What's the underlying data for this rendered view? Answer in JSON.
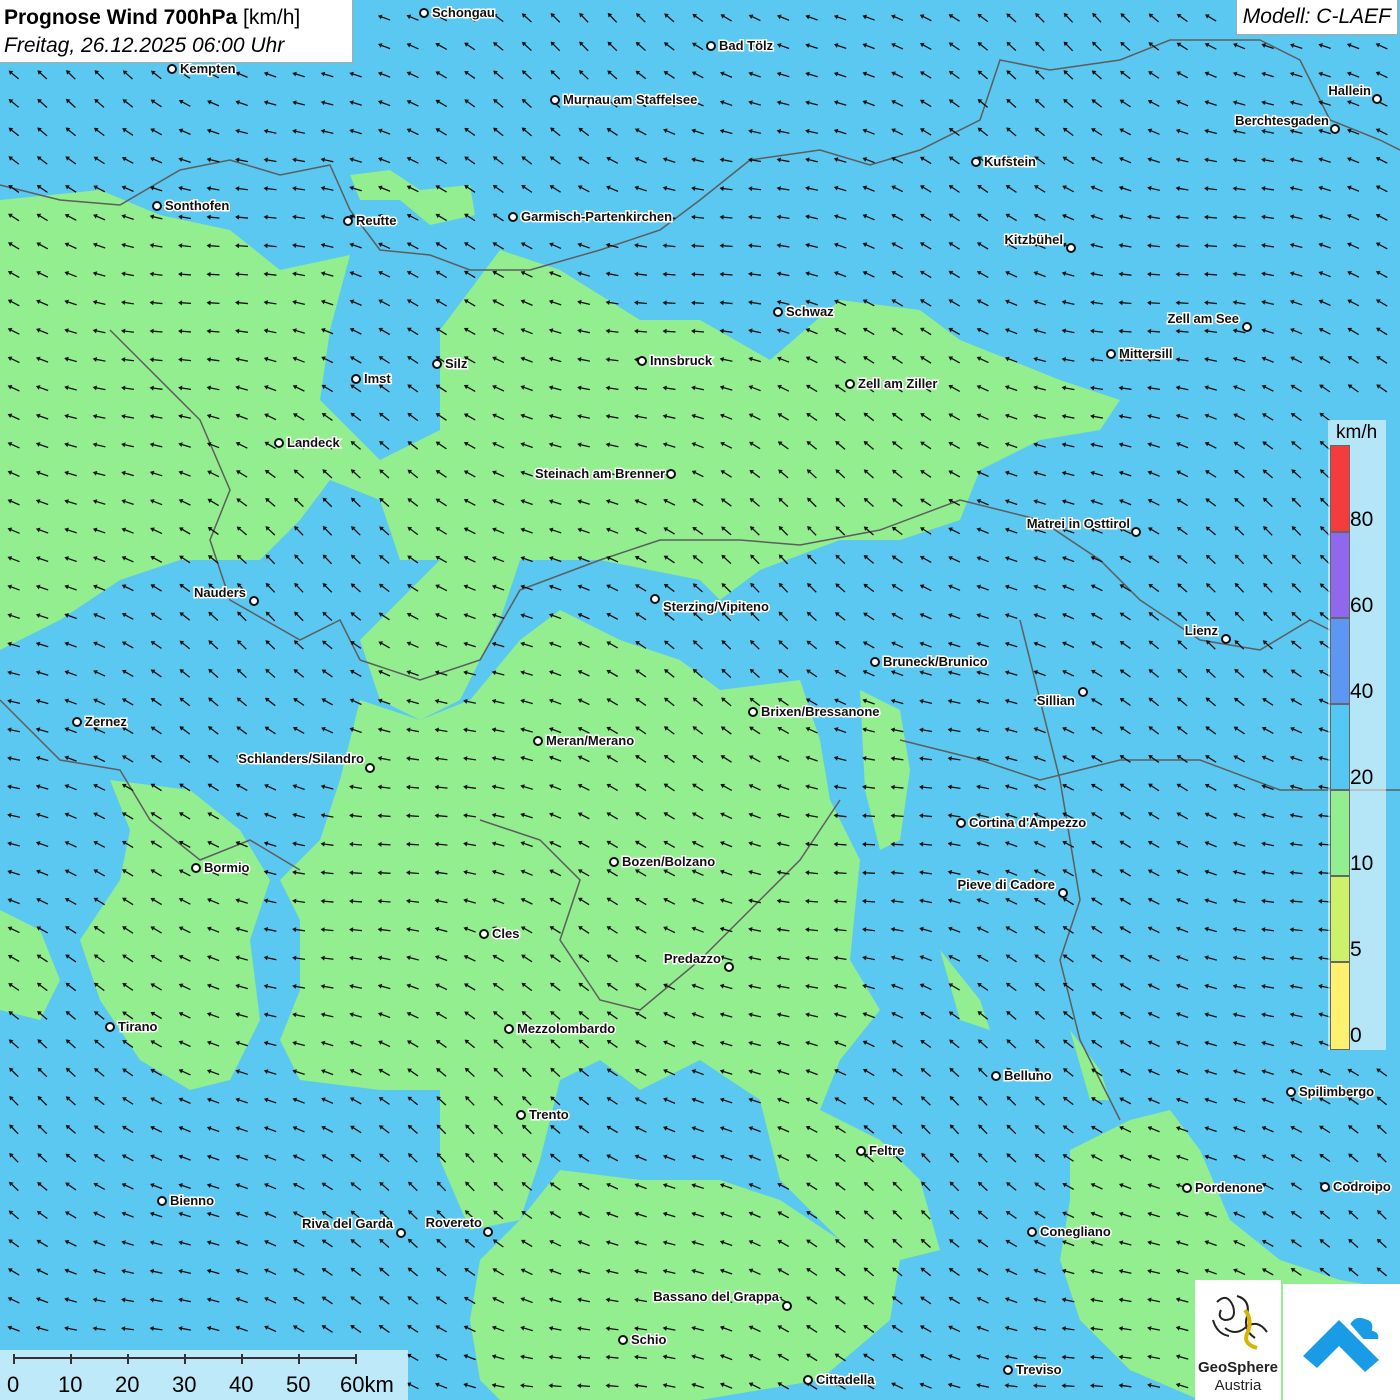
{
  "title": {
    "bold": "Prognose Wind 700hPa",
    "unit": "[km/h]",
    "datetime": "Freitag, 26.12.2025 06:00 Uhr"
  },
  "model": "Modell: C-LAEF",
  "legend": {
    "unit": "km/h",
    "ticks": [
      "0",
      "5",
      "10",
      "20",
      "40",
      "60",
      "80"
    ],
    "colors": [
      "#fff170",
      "#cdf26a",
      "#92ee8e",
      "#54c8f4",
      "#5e96f4",
      "#9068ee",
      "#f43c3c"
    ]
  },
  "scalebar": {
    "labels": [
      "0",
      "10",
      "20",
      "30",
      "40",
      "50",
      "60km"
    ]
  },
  "colors": {
    "wind_10_20": "#92ee8e",
    "wind_20_40": "#5ac8f0",
    "borders": "#5d5d5d",
    "arrows": "#111111"
  },
  "cities": [
    {
      "name": "Schongau",
      "side": "right"
    },
    {
      "name": "Bad Tölz",
      "side": "right"
    },
    {
      "name": "Kempten",
      "side": "right"
    },
    {
      "name": "Murnau am Staffelsee",
      "side": "right"
    },
    {
      "name": "Hallein",
      "side": "left"
    },
    {
      "name": "Berchtesgaden",
      "side": "left"
    },
    {
      "name": "Kufstein",
      "side": "right"
    },
    {
      "name": "Sonthofen",
      "side": "right"
    },
    {
      "name": "Reutte",
      "side": "right"
    },
    {
      "name": "Garmisch-Partenkirchen",
      "side": "right"
    },
    {
      "name": "Kitzbühel",
      "side": "left"
    },
    {
      "name": "Schwaz",
      "side": "right"
    },
    {
      "name": "Zell am See",
      "side": "left"
    },
    {
      "name": "Mittersill",
      "side": "right"
    },
    {
      "name": "Innsbruck",
      "side": "right"
    },
    {
      "name": "Silz",
      "side": "right"
    },
    {
      "name": "Imst",
      "side": "right"
    },
    {
      "name": "Zell am Ziller",
      "side": "right"
    },
    {
      "name": "Landeck",
      "side": "right"
    },
    {
      "name": "Steinach am Brenner",
      "side": "left"
    },
    {
      "name": "Matrei in Osttirol",
      "side": "left"
    },
    {
      "name": "Nauders",
      "side": "left"
    },
    {
      "name": "Sterzing/Vipiteno",
      "side": "right"
    },
    {
      "name": "Lienz",
      "side": "left"
    },
    {
      "name": "Bruneck/Brunico",
      "side": "right"
    },
    {
      "name": "Sillian",
      "side": "left"
    },
    {
      "name": "Brixen/Bressanone",
      "side": "right"
    },
    {
      "name": "Zernez",
      "side": "right"
    },
    {
      "name": "Meran/Merano",
      "side": "right"
    },
    {
      "name": "Schlanders/Silandro",
      "side": "left"
    },
    {
      "name": "Cortina d'Ampezzo",
      "side": "right"
    },
    {
      "name": "Bozen/Bolzano",
      "side": "right"
    },
    {
      "name": "Bormio",
      "side": "right"
    },
    {
      "name": "Pieve di Cadore",
      "side": "left"
    },
    {
      "name": "Cles",
      "side": "right"
    },
    {
      "name": "Predazzo",
      "side": "left"
    },
    {
      "name": "Tirano",
      "side": "right"
    },
    {
      "name": "Mezzolombardo",
      "side": "right"
    },
    {
      "name": "Belluno",
      "side": "right"
    },
    {
      "name": "Spilimbergo",
      "side": "right"
    },
    {
      "name": "Trento",
      "side": "right"
    },
    {
      "name": "Feltre",
      "side": "right"
    },
    {
      "name": "Pordenone",
      "side": "right"
    },
    {
      "name": "Codroipo",
      "side": "right"
    },
    {
      "name": "Bienno",
      "side": "right"
    },
    {
      "name": "Riva del Garda",
      "side": "left"
    },
    {
      "name": "Rovereto",
      "side": "left"
    },
    {
      "name": "Conegliano",
      "side": "right"
    },
    {
      "name": "Bassano del Grappa",
      "side": "left"
    },
    {
      "name": "Schio",
      "side": "right"
    },
    {
      "name": "Treviso",
      "side": "right"
    },
    {
      "name": "Cittadella",
      "side": "right"
    }
  ],
  "logos": {
    "geosphere_line1": "GeoSphere",
    "geosphere_line2": "Austria"
  }
}
